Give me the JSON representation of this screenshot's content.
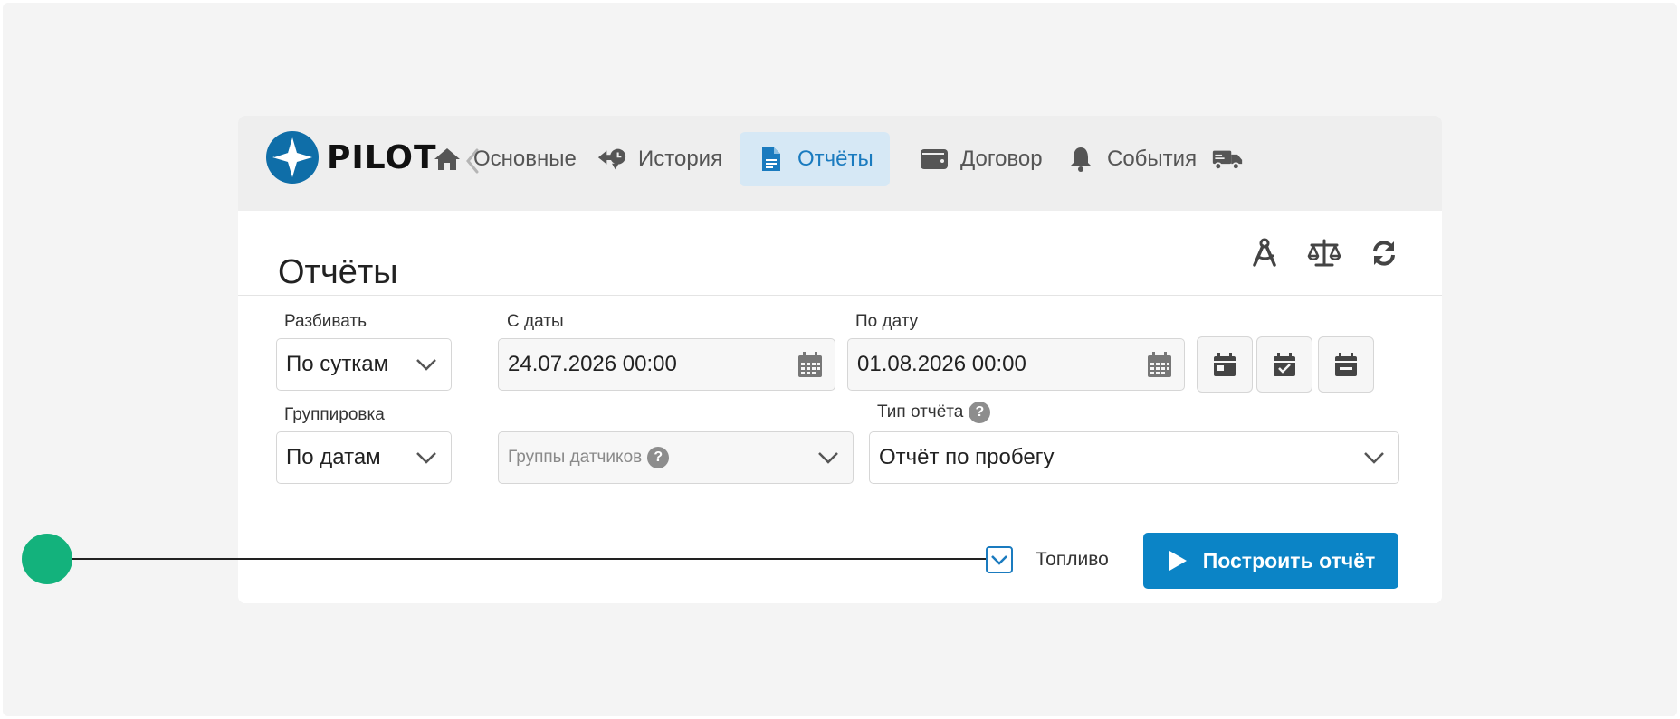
{
  "brand": {
    "name": "PILOT",
    "color": "#0f6ea8"
  },
  "nav": {
    "back_icon": "chevron-left-icon",
    "items": [
      {
        "label": "Основные",
        "icon": "home-icon",
        "active": false
      },
      {
        "label": "История",
        "icon": "history-icon",
        "active": false
      },
      {
        "label": "Отчёты",
        "icon": "file-icon",
        "active": true
      },
      {
        "label": "Договор",
        "icon": "wallet-icon",
        "active": false
      },
      {
        "label": "События",
        "icon": "bell-icon",
        "active": false
      },
      {
        "label": "",
        "icon": "truck-icon",
        "active": false
      }
    ]
  },
  "header": {
    "title": "Отчёты",
    "actions": [
      "compass-icon",
      "scales-icon",
      "refresh-icon"
    ]
  },
  "form": {
    "split": {
      "label": "Разбивать",
      "value": "По суткам"
    },
    "date_from": {
      "label": "С даты",
      "value": "24.07.2026 00:00"
    },
    "date_to": {
      "label": "По дату",
      "value": "01.08.2026 00:00"
    },
    "quick_dates": [
      "calendar-day-icon",
      "calendar-check-icon",
      "calendar-minus-icon"
    ],
    "grouping": {
      "label": "Группировка",
      "value": "По датам"
    },
    "sensor_groups": {
      "placeholder": "Группы датчиков",
      "help": "?"
    },
    "report_type": {
      "label": "Тип отчёта",
      "help": "?",
      "value": "Отчёт по пробегу"
    },
    "fuel": {
      "label": "Топливо",
      "checked": true
    },
    "build_button": {
      "label": "Построить отчёт"
    }
  },
  "colors": {
    "accent": "#0b84c6",
    "nav_active_bg": "#d6e8f5",
    "pointer_dot": "#13b27c"
  }
}
